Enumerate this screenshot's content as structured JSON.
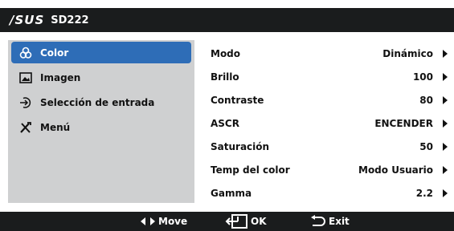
{
  "header": {
    "logo": "/SUS",
    "model": "SD222"
  },
  "sidebar": {
    "items": [
      {
        "label": "Color",
        "icon": "color-palette-icon"
      },
      {
        "label": "Imagen",
        "icon": "image-icon"
      },
      {
        "label": "Selección de entrada",
        "icon": "input-source-icon"
      },
      {
        "label": "Menú",
        "icon": "tools-icon"
      }
    ]
  },
  "settings": [
    {
      "label": "Modo",
      "value": "Dinámico"
    },
    {
      "label": "Brillo",
      "value": "100"
    },
    {
      "label": "Contraste",
      "value": "80"
    },
    {
      "label": "ASCR",
      "value": "ENCENDER"
    },
    {
      "label": "Saturación",
      "value": "50"
    },
    {
      "label": "Temp del color",
      "value": "Modo Usuario"
    },
    {
      "label": "Gamma",
      "value": "2.2"
    }
  ],
  "footer": {
    "move": "Move",
    "ok": "OK",
    "exit": "Exit"
  },
  "colors": {
    "header_bg": "#1a1c1d",
    "sidebar_bg": "#cfd0d1",
    "accent": "#2e6db7"
  }
}
